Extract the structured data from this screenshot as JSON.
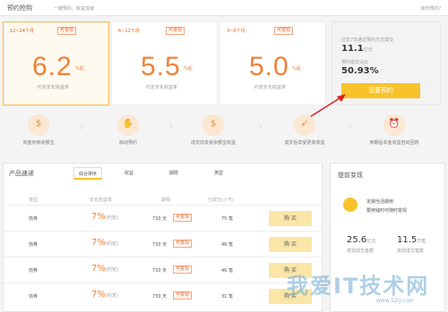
{
  "header": {
    "title": "预约抢购",
    "subtitle": "一键预约，收益加速",
    "help": "如何预约?"
  },
  "cards": [
    {
      "term": "12~24个月",
      "tag": "可变现",
      "rate": "6.2",
      "pct": "%起",
      "label": "约定年化收益率"
    },
    {
      "term": "6~12个月",
      "tag": "可变现",
      "rate": "5.5",
      "pct": "%起",
      "label": "约定年化收益率"
    },
    {
      "term": "3~6个月",
      "tag": "可变现",
      "rate": "5.0",
      "pct": "%起",
      "label": "约定年化收益率"
    }
  ],
  "stats": {
    "cap1": "过去7日通过预约方式成交",
    "val1": "11.1",
    "unit1": "亿元",
    "cap2": "预约成交占比",
    "val2": "50.93",
    "unit2": "%",
    "button": "设置预约"
  },
  "flow": [
    {
      "icon": "money-bag-icon",
      "glyph": "$",
      "label": "资金存到余额宝"
    },
    {
      "icon": "hand-icon",
      "glyph": "✋",
      "label": "启动预约"
    },
    {
      "icon": "money-bag-icon",
      "glyph": "$",
      "label": "成交前享受余额宝收益"
    },
    {
      "icon": "rocket-icon",
      "glyph": "➶",
      "label": "成交后享受更高收益"
    },
    {
      "icon": "alarm-icon",
      "glyph": "⏰",
      "label": "到期后本金收益自动回购"
    }
  ],
  "products": {
    "title": "产品速递",
    "tabs": [
      "综合排序",
      "收益",
      "期限",
      "类型"
    ],
    "columns": [
      "类型",
      "年化收益率",
      "期限",
      "已成交(人气)"
    ],
    "rows": [
      {
        "type": "债券",
        "rate": "7%",
        "rate_unit": "(约定)",
        "days": "730 天",
        "tag": "可变现",
        "count": "75 笔",
        "buy": "购 买"
      },
      {
        "type": "债券",
        "rate": "7%",
        "rate_unit": "(约定)",
        "days": "730 天",
        "tag": "可变现",
        "count": "46 笔",
        "buy": "购 买"
      },
      {
        "type": "债券",
        "rate": "7%",
        "rate_unit": "(约定)",
        "days": "730 天",
        "tag": "可变现",
        "count": "46 笔",
        "buy": "购 买"
      },
      {
        "type": "债券",
        "rate": "7%",
        "rate_unit": "(约定)",
        "days": "730 天",
        "tag": "可变现",
        "count": "31 笔",
        "buy": "购 买"
      }
    ]
  },
  "side": {
    "title": "提前变现",
    "line1": "定期当活期用",
    "line2": "要用钱时可随时变现",
    "v1": "25.6",
    "v1_unit": "亿元",
    "v2": "11.5",
    "v2_unit": "万笔",
    "cap1": "变现成交金额",
    "cap2": "变现成交笔数"
  },
  "watermark": {
    "text": "我爱IT技术网",
    "url": "www.52ij.com"
  }
}
